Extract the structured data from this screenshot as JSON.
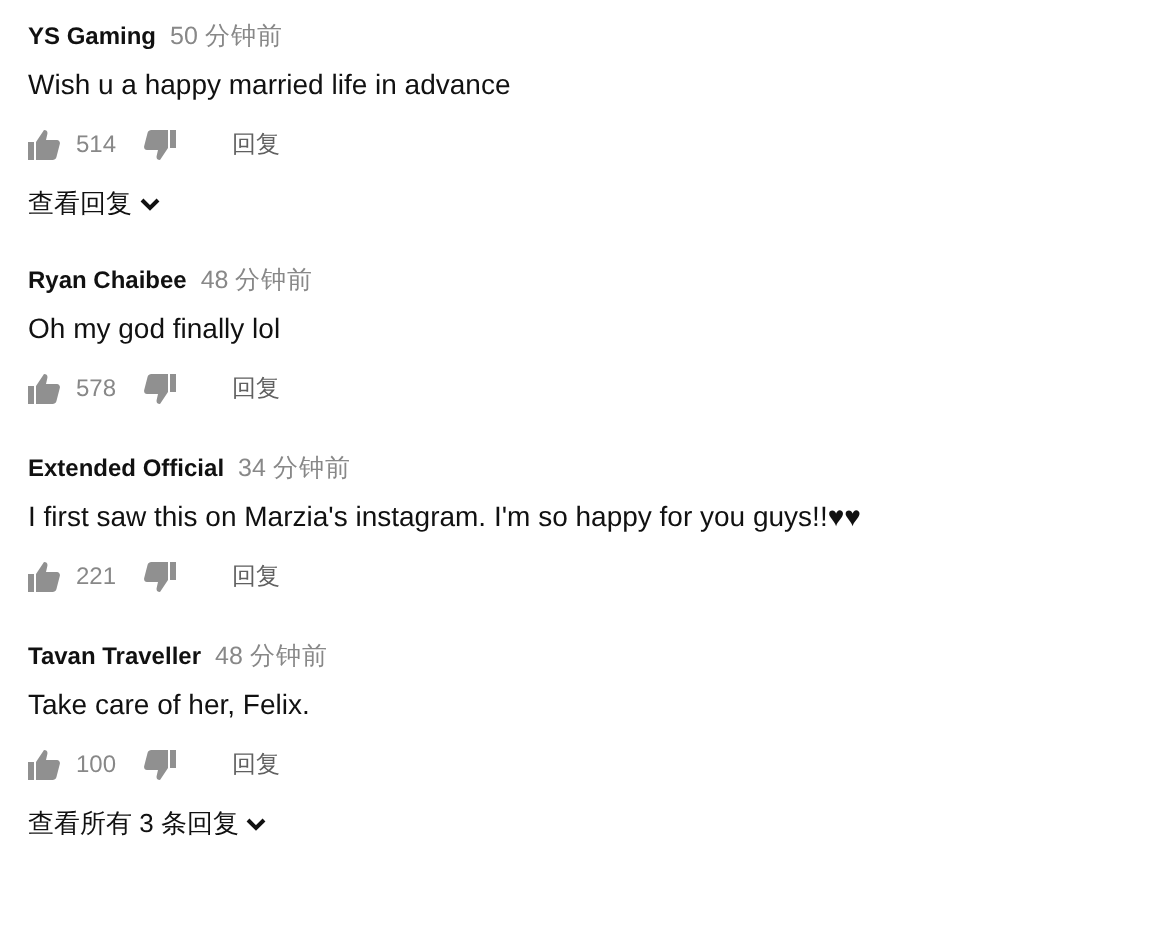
{
  "comments": [
    {
      "author": "YS Gaming",
      "time": "50 分钟前",
      "text": "Wish u a happy married life in advance",
      "likes": "514",
      "reply": "回复",
      "view_replies": "查看回复"
    },
    {
      "author": "Ryan Chaibee",
      "time": "48 分钟前",
      "text": "Oh my god finally lol",
      "likes": "578",
      "reply": "回复"
    },
    {
      "author": "Extended Official",
      "time": "34 分钟前",
      "text": "I first saw this on Marzia's instagram. I'm so happy for you guys!!♥♥",
      "likes": "221",
      "reply": "回复"
    },
    {
      "author": "Tavan Traveller",
      "time": "48 分钟前",
      "text": "Take care of her, Felix.",
      "likes": "100",
      "reply": "回复",
      "view_replies": "查看所有 3 条回复"
    }
  ]
}
